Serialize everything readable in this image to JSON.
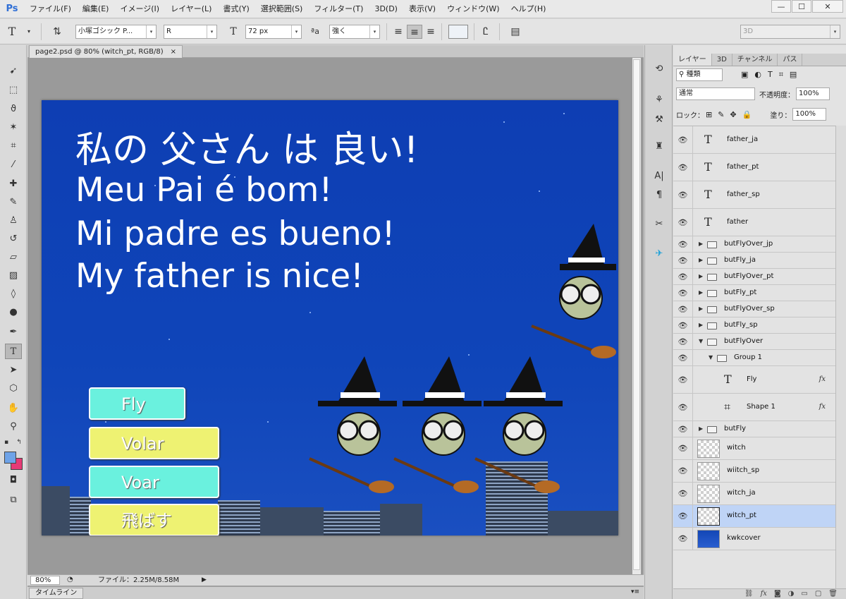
{
  "app": {
    "logo": "Ps",
    "menu": [
      "ファイル(F)",
      "編集(E)",
      "イメージ(I)",
      "レイヤー(L)",
      "書式(Y)",
      "選択範囲(S)",
      "フィルター(T)",
      "3D(D)",
      "表示(V)",
      "ウィンドウ(W)",
      "ヘルプ(H)"
    ],
    "window_controls": [
      "—",
      "☐",
      "✕"
    ]
  },
  "options_bar": {
    "tool_glyph": "T",
    "font_family": "小塚ゴシック P...",
    "font_style": "R",
    "font_size": "72 px",
    "antialias_label": "ªa",
    "antialias": "強く",
    "workspace": "3D"
  },
  "document": {
    "tab_title": "page2.psd @ 80% (witch_pt, RGB/8)",
    "tab_close": "×",
    "zoom": "80%",
    "file_info": "ファイル：2.25M/8.58M",
    "timeline_label": "タイムライン"
  },
  "canvas": {
    "headlines": [
      "私の 父さん は 良い!",
      "Meu Pai é bom!",
      "Mi padre es bueno!",
      "My father is nice!"
    ],
    "buttons": [
      {
        "label": "Fly",
        "color": "#6af1de"
      },
      {
        "label": "Volar",
        "color": "#eef272"
      },
      {
        "label": "Voar",
        "color": "#6af1de"
      },
      {
        "label": "飛ばす",
        "color": "#eef272"
      }
    ]
  },
  "layers_panel": {
    "tabs": [
      "レイヤー",
      "3D",
      "チャンネル",
      "パス"
    ],
    "kind_filter": "種類",
    "blend_mode": "通常",
    "opacity_label": "不透明度：",
    "opacity": "100%",
    "lock_label": "ロック：",
    "fill_label": "塗り：",
    "fill": "100%",
    "layers": [
      {
        "name": "father_ja",
        "type": "text"
      },
      {
        "name": "father_pt",
        "type": "text"
      },
      {
        "name": "father_sp",
        "type": "text"
      },
      {
        "name": "father",
        "type": "text"
      },
      {
        "name": "butFlyOver_jp",
        "type": "group"
      },
      {
        "name": "butFly_ja",
        "type": "group"
      },
      {
        "name": "butFlyOver_pt",
        "type": "group"
      },
      {
        "name": "butFly_pt",
        "type": "group"
      },
      {
        "name": "butFlyOver_sp",
        "type": "group"
      },
      {
        "name": "butFly_sp",
        "type": "group"
      },
      {
        "name": "butFlyOver",
        "type": "group-open"
      },
      {
        "name": "Group 1",
        "type": "group-open"
      },
      {
        "name": "Fly",
        "type": "text",
        "fx": "fx"
      },
      {
        "name": "Shape 1",
        "type": "shape",
        "fx": "fx"
      },
      {
        "name": "butFly",
        "type": "group"
      },
      {
        "name": "witch",
        "type": "pixel"
      },
      {
        "name": "wiitch_sp",
        "type": "pixel"
      },
      {
        "name": "witch_ja",
        "type": "pixel"
      },
      {
        "name": "witch_pt",
        "type": "pixel",
        "selected": true
      },
      {
        "name": "kwkcover",
        "type": "cover"
      }
    ],
    "footer_icons": [
      "link-icon",
      "fx-icon",
      "mask-icon",
      "adjustment-icon",
      "folder-icon",
      "new-layer-icon",
      "trash-icon"
    ]
  }
}
